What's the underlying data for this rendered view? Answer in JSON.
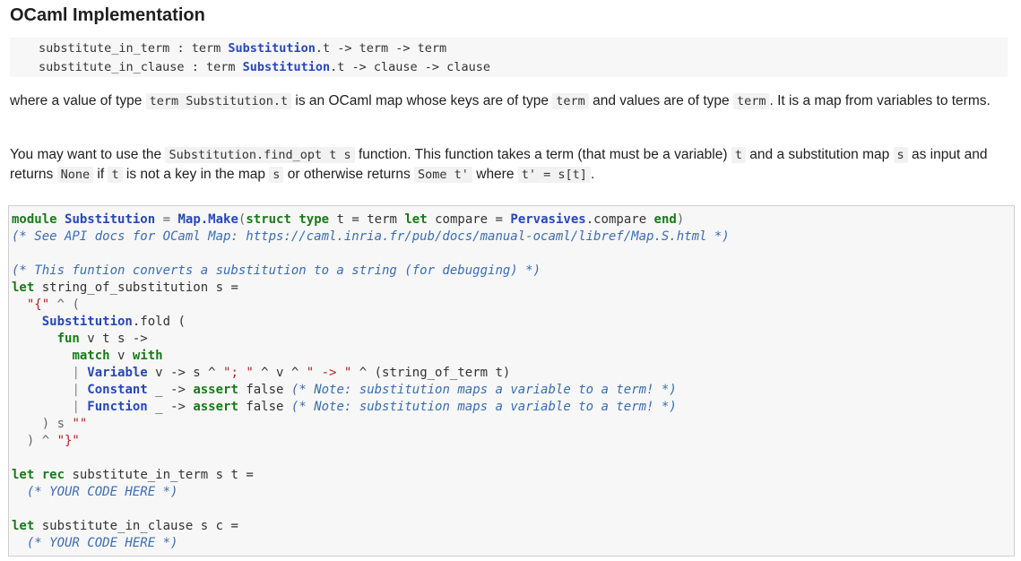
{
  "heading": "OCaml Implementation",
  "signature": {
    "line1": {
      "name": "substitute_in_term",
      "sep": " : ",
      "t1": "term ",
      "mod": "Substitution",
      "rest": ".t -> term -> term"
    },
    "line2": {
      "name": "substitute_in_clause",
      "sep": " : ",
      "t1": "term ",
      "mod": "Substitution",
      "rest": ".t -> clause -> clause"
    }
  },
  "para1": {
    "a": "where a value of type ",
    "code1": "term Substitution.t",
    "b": " is an OCaml map whose keys are of type ",
    "code2": "term",
    "c": " and values are of type ",
    "code3": "term",
    "d": ". It is a map from variables to terms."
  },
  "para2": {
    "a": "You may want to use the ",
    "code1": "Substitution.find_opt t s",
    "b": " function. This function takes a term (that must be a variable) ",
    "code2": "t",
    "c": " and a substitution map ",
    "code3": "s",
    "d": " as input and returns ",
    "code4": "None",
    "e": " if ",
    "code5": "t",
    "f": " is not a key in the map ",
    "code6": "s",
    "g": " or otherwise returns ",
    "code7": "Some t'",
    "h": " where ",
    "code8": "t' = s[t]",
    "i": "."
  },
  "code": {
    "l1": {
      "k1": "module",
      "m1": "Substitution",
      "o1": " = ",
      "m2": "Map.Make",
      "o2": "(",
      "k2": "struct",
      "sp": " ",
      "k3": "type",
      "t1": " t = term ",
      "k4": "let",
      "t2": " compare = ",
      "m3": "Pervasives",
      "t3": ".compare ",
      "k5": "end",
      "o3": ")"
    },
    "l2": "(* See API docs for OCaml Map: https://caml.inria.fr/pub/docs/manual-ocaml/libref/Map.S.html *)",
    "l3": "(* This funtion converts a substitution to a string (for debugging) *)",
    "l4": {
      "k": "let",
      "t": " string_of_substitution s ="
    },
    "l5": {
      "ind": "  ",
      "s": "\"{\"",
      "t": " ^ ("
    },
    "l6": {
      "ind": "    ",
      "m": "Substitution",
      "t": ".fold ("
    },
    "l7": {
      "ind": "      ",
      "k": "fun",
      "t": " v t s ->"
    },
    "l8": {
      "ind": "        ",
      "k1": "match",
      "t": " v ",
      "k2": "with"
    },
    "l9": {
      "ind": "        ",
      "bar": "| ",
      "m": "Variable",
      "t1": " v -> s ^ ",
      "s1": "\"; \"",
      "t2": " ^ v ^ ",
      "s2": "\" -> \"",
      "t3": " ^ (string_of_term t)"
    },
    "l10": {
      "ind": "        ",
      "bar": "| ",
      "m": "Constant",
      "t1": " _ -> ",
      "k": "assert",
      "t2": " false ",
      "c": "(* Note: substitution maps a variable to a term! *)"
    },
    "l11": {
      "ind": "        ",
      "bar": "| ",
      "m": "Function",
      "t1": " _ -> ",
      "k": "assert",
      "t2": " false ",
      "c": "(* Note: substitution maps a variable to a term! *)"
    },
    "l12": {
      "ind": "    ",
      "t": ") s ",
      "s": "\"\""
    },
    "l13": {
      "ind": "  ",
      "t": ") ^ ",
      "s": "\"}\""
    },
    "l14": {
      "k1": "let",
      "sp": " ",
      "k2": "rec",
      "t": " substitute_in_term s t ="
    },
    "l15": {
      "ind": "  ",
      "c": "(* YOUR CODE HERE *)"
    },
    "l16": {
      "k": "let",
      "t": " substitute_in_clause s c ="
    },
    "l17": {
      "ind": "  ",
      "c": "(* YOUR CODE HERE *)"
    }
  }
}
